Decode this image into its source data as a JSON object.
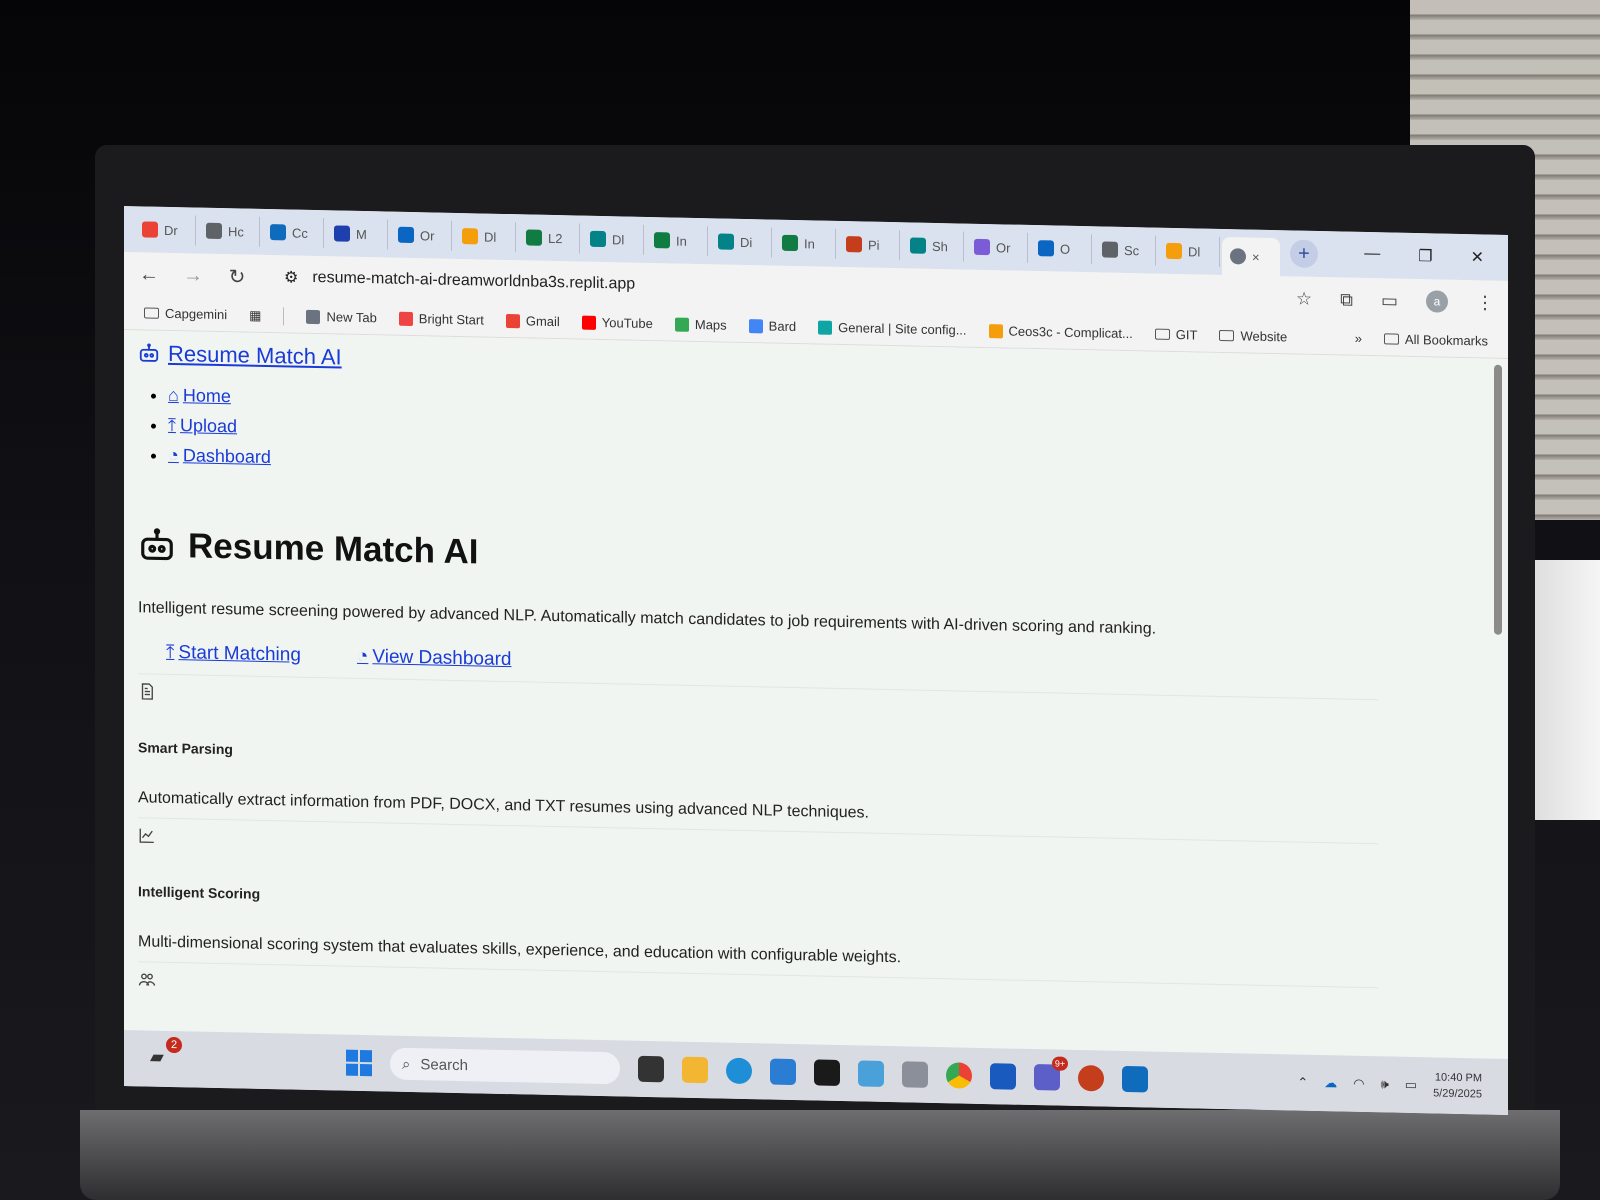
{
  "browser": {
    "tabs": [
      {
        "label": "Dr",
        "color": "#ea4335"
      },
      {
        "label": "Hc",
        "color": "#5f6368"
      },
      {
        "label": "Cc",
        "color": "#0f6cbd"
      },
      {
        "label": "M",
        "color": "#1e40af"
      },
      {
        "label": "Or",
        "color": "#0a66c2"
      },
      {
        "label": "Dl",
        "color": "#f59e0b"
      },
      {
        "label": "L2",
        "color": "#107c41"
      },
      {
        "label": "Dl",
        "color": "#038387"
      },
      {
        "label": "In",
        "color": "#107c41"
      },
      {
        "label": "Di",
        "color": "#038387"
      },
      {
        "label": "In",
        "color": "#107c41"
      },
      {
        "label": "Pi",
        "color": "#c43e1c"
      },
      {
        "label": "Sh",
        "color": "#038387"
      },
      {
        "label": "Or",
        "color": "#7b5cd6"
      },
      {
        "label": "O",
        "color": "#0a66c2"
      },
      {
        "label": "Sc",
        "color": "#5f6368"
      },
      {
        "label": "Dl",
        "color": "#f59e0b"
      }
    ],
    "active_tab_close": "×",
    "new_tab": "+",
    "url": "resume-match-ai-dreamworldnba3s.replit.app",
    "bookmarks": [
      {
        "label": "Capgemini",
        "kind": "folder-icon"
      },
      {
        "label": "New Tab",
        "color": "#6b7280"
      },
      {
        "label": "Bright Start",
        "color": "#ef4444"
      },
      {
        "label": "Gmail",
        "color": "#ea4335"
      },
      {
        "label": "YouTube",
        "color": "#ff0000"
      },
      {
        "label": "Maps",
        "color": "#34a853"
      },
      {
        "label": "Bard",
        "color": "#4285f4"
      },
      {
        "label": "General | Site config...",
        "color": "#0ea5a4"
      },
      {
        "label": "Ceos3c - Complicat...",
        "color": "#f59e0b"
      },
      {
        "label": "GIT",
        "kind": "folder-icon"
      },
      {
        "label": "Website",
        "kind": "folder-icon"
      }
    ],
    "overflow": "»",
    "all_bookmarks": "All Bookmarks",
    "profile_initial": "a"
  },
  "app": {
    "brand": "Resume Match AI",
    "nav": [
      "Home",
      "Upload",
      "Dashboard"
    ],
    "hero_title": "Resume Match AI",
    "hero_desc": "Intelligent resume screening powered by advanced NLP. Automatically match candidates to job requirements with AI-driven scoring and ranking.",
    "cta_primary": "Start Matching",
    "cta_secondary": "View Dashboard",
    "features": [
      {
        "title": "Smart Parsing",
        "desc": "Automatically extract information from PDF, DOCX, and TXT resumes using advanced NLP techniques.",
        "icon": "document-icon"
      },
      {
        "title": "Intelligent Scoring",
        "desc": "Multi-dimensional scoring system that evaluates skills, experience, and education with configurable weights.",
        "icon": "chart-line-icon"
      }
    ]
  },
  "taskbar": {
    "search_placeholder": "Search",
    "notification_count": "2",
    "teams_badge": "9+",
    "time": "10:40 PM",
    "date": "5/29/2025"
  }
}
